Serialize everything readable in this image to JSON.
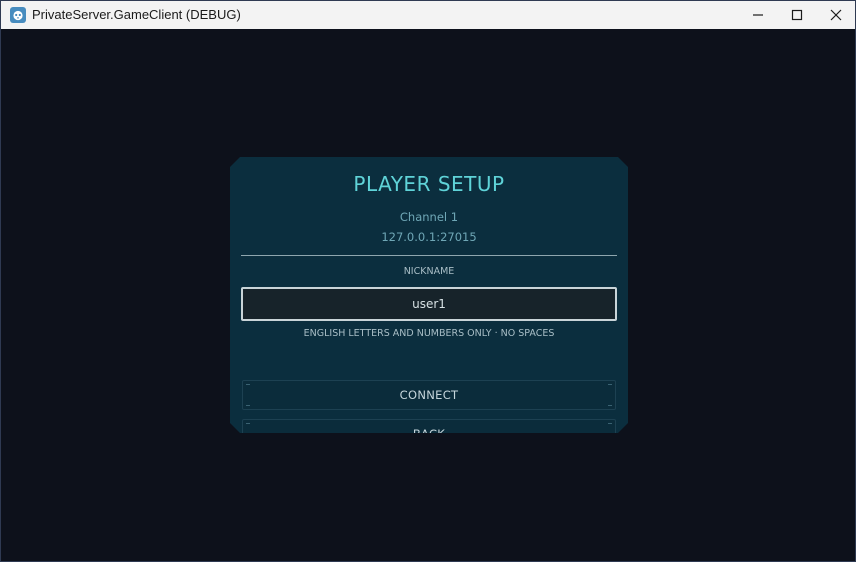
{
  "window": {
    "title": "PrivateServer.GameClient (DEBUG)",
    "app_icon": "godot-icon",
    "controls": [
      "minimize-icon",
      "maximize-icon",
      "close-icon"
    ]
  },
  "panel": {
    "title": "PLAYER SETUP",
    "channel": "Channel 1",
    "server_address": "127.0.0.1:27015",
    "nickname_label": "NICKNAME",
    "nickname_value": "user1",
    "hint": "ENGLISH LETTERS AND NUMBERS ONLY · NO SPACES",
    "connect_label": "CONNECT",
    "back_label": "BACK"
  },
  "colors": {
    "background": "#0d111b",
    "panel": "#0b2e3e",
    "title_accent": "#5fd3d8",
    "subtitle": "#6fa7b6"
  }
}
